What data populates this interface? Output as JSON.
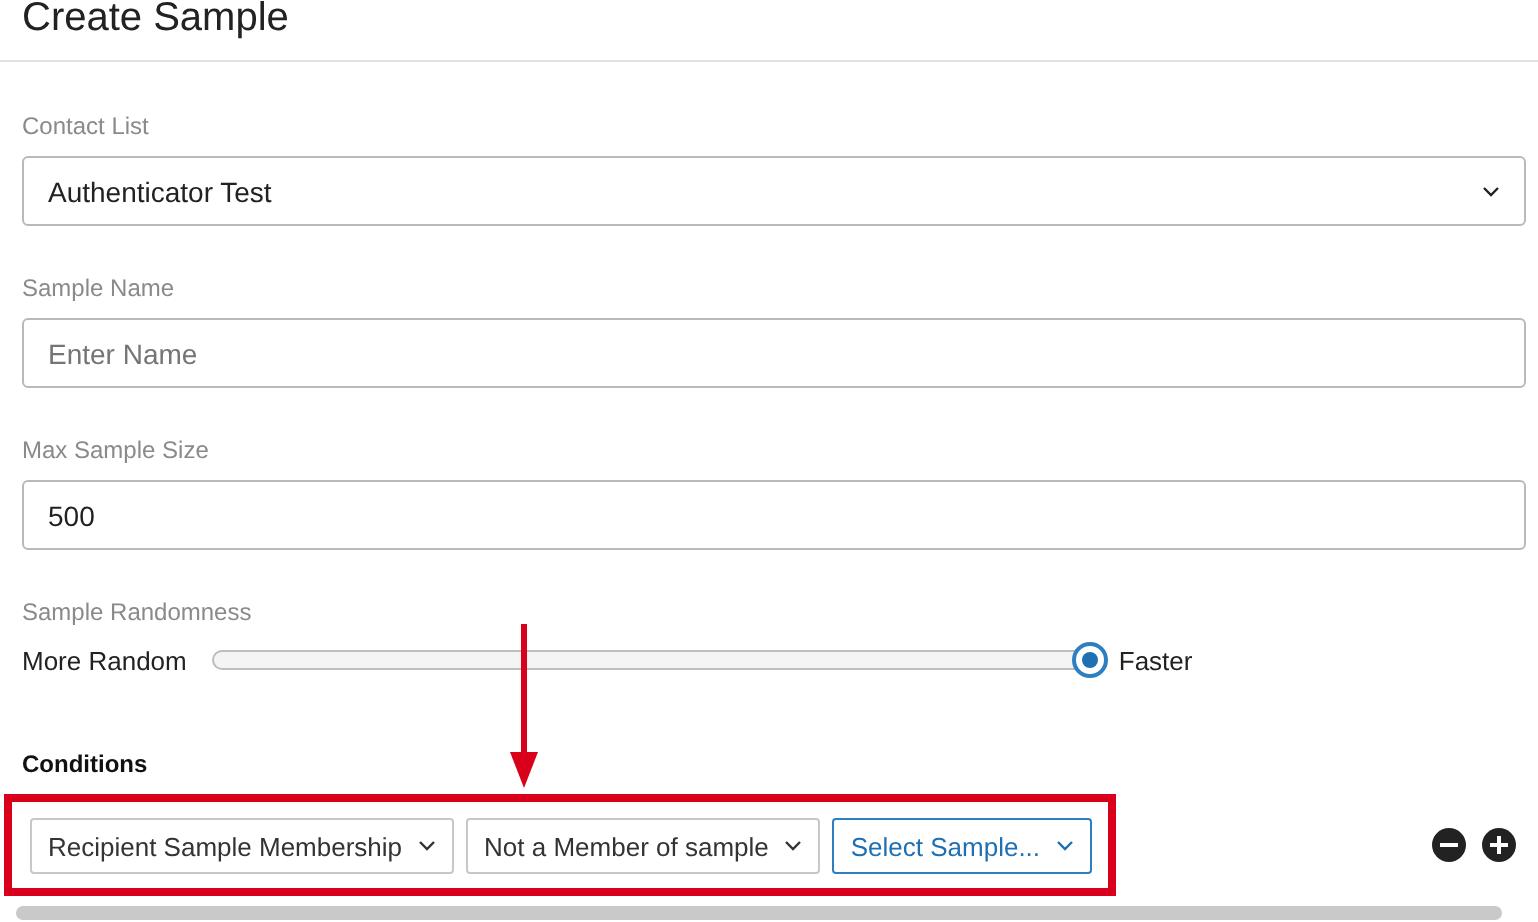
{
  "title": "Create Sample",
  "fields": [
    {
      "label": "Contact List",
      "kind": "select",
      "value": "Authenticator Test"
    },
    {
      "label": "Sample Name",
      "kind": "text",
      "placeholder": "Enter Name"
    },
    {
      "label": "Max Sample Size",
      "kind": "text",
      "value": "500"
    }
  ],
  "randomness": {
    "label": "Sample Randomness",
    "left": "More Random",
    "right": "Faster",
    "level": 1
  },
  "conditions": {
    "heading": "Conditions",
    "dropdowns": [
      {
        "label": "Recipient Sample Membership",
        "kind": "value"
      },
      {
        "label": "Not a Member of sample",
        "kind": "value"
      },
      {
        "label": "Select Sample...",
        "kind": "prompt"
      }
    ]
  }
}
